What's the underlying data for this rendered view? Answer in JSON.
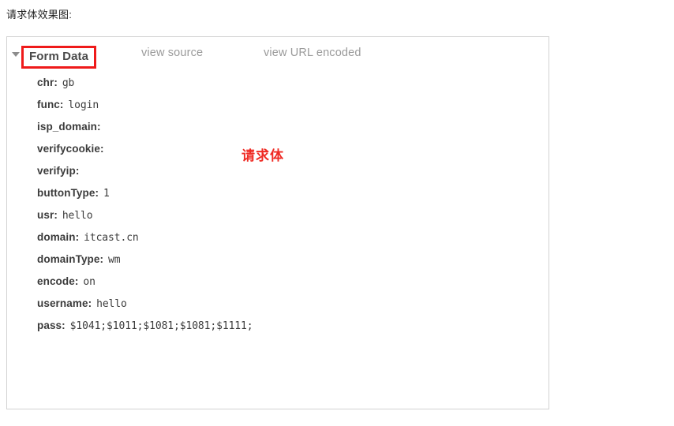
{
  "page": {
    "caption": "请求体效果图:"
  },
  "panel": {
    "header": {
      "disclosure_icon": "triangle-down-icon",
      "title": "Form Data",
      "title_highlight_color": "#ef1a1a",
      "tabs": [
        {
          "label": "view source"
        },
        {
          "label": "view URL encoded"
        }
      ]
    },
    "rows": [
      {
        "key": "chr",
        "sep": ":",
        "value": "gb"
      },
      {
        "key": "func",
        "sep": ":",
        "value": "login"
      },
      {
        "key": "isp_domain",
        "sep": ":",
        "value": ""
      },
      {
        "key": "verifycookie",
        "sep": ":",
        "value": ""
      },
      {
        "key": "verifyip",
        "sep": ":",
        "value": ""
      },
      {
        "key": "buttonType",
        "sep": ":",
        "value": "1"
      },
      {
        "key": "usr",
        "sep": ":",
        "value": "hello"
      },
      {
        "key": "domain",
        "sep": ":",
        "value": "itcast.cn"
      },
      {
        "key": "domainType",
        "sep": ":",
        "value": "wm"
      },
      {
        "key": "encode",
        "sep": ":",
        "value": "on"
      },
      {
        "key": "username",
        "sep": ":",
        "value": "hello"
      },
      {
        "key": "pass",
        "sep": ":",
        "value": "$1041;$1011;$1081;$1081;$1111;"
      }
    ]
  },
  "annotation": {
    "text": "请求体",
    "color": "#ef2b24"
  }
}
